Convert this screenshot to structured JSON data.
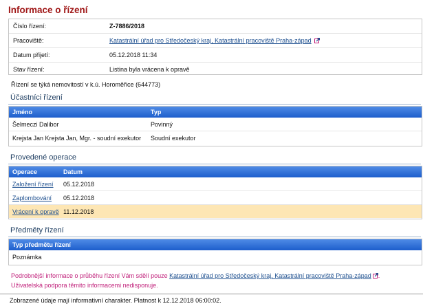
{
  "page_title": "Informace o řízení",
  "info": {
    "rows": [
      {
        "label": "Číslo řízení:",
        "value": "Z-7886/2018"
      },
      {
        "label": "Pracoviště:",
        "value": "Katastrální úřad pro Středočeský kraj, Katastrální pracoviště Praha-západ"
      },
      {
        "label": "Datum přijetí:",
        "value": "05.12.2018 11:34"
      },
      {
        "label": "Stav řízení:",
        "value": "Listina byla vrácena k opravě"
      }
    ]
  },
  "property_note": "Řízení se týká nemovitostí v k.ú. Horoměřice (644773)",
  "participants": {
    "title": "Účastníci řízení",
    "columns": [
      "Jméno",
      "Typ"
    ],
    "rows": [
      [
        "Šelmeczi Dalibor",
        "Povinný"
      ],
      [
        "Krejsta Jan Krejsta Jan, Mgr. - soudní exekutor",
        "Soudní exekutor"
      ]
    ]
  },
  "operations": {
    "title": "Provedené operace",
    "columns": [
      "Operace",
      "Datum"
    ],
    "rows": [
      [
        "Založení řízení",
        "05.12.2018"
      ],
      [
        "Zaplombování",
        "05.12.2018"
      ],
      [
        "Vrácení k opravě",
        "11.12.2018"
      ]
    ]
  },
  "subjects": {
    "title": "Předměty řízení",
    "columns": [
      "Typ předmětu řízení"
    ],
    "rows": [
      [
        "Poznámka"
      ]
    ]
  },
  "notice": {
    "prefix": "Podrobnější informace o průběhu řízení Vám sdělí pouze ",
    "link": "Katastrální úřad pro Středočeský kraj, Katastrální pracoviště Praha-západ",
    "suffix": ".",
    "line2": "Uživatelská podpora těmito informacemi nedisponuje."
  },
  "footer": "Zobrazené údaje mají informativní charakter. Platnost k 12.12.2018 06:00:02.",
  "colors": {
    "title": "#a01818",
    "header": "#2a6cd6",
    "highlight": "#fde6b4",
    "notice": "#c0207a",
    "link": "#1d4f8f"
  },
  "icons": [
    "external-link-icon"
  ]
}
